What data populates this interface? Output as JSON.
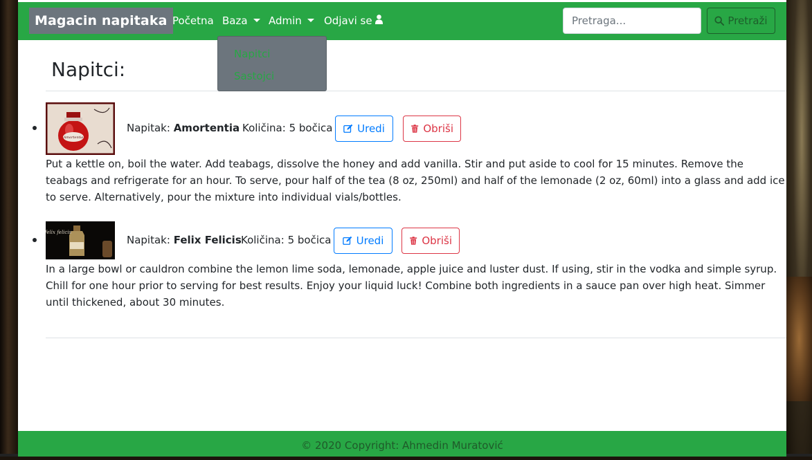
{
  "navbar": {
    "brand": "Magacin napitaka",
    "home_label": "Početna",
    "baza_label": "Baza",
    "admin_label": "Admin",
    "logout_label": "Odjavi se",
    "search_placeholder": "Pretraga...",
    "search_button": "Pretraži"
  },
  "dropdown": {
    "items": [
      "Napitci",
      "Sastojci"
    ]
  },
  "main": {
    "title": "Napitci:",
    "drinks": [
      {
        "drink_label": "Napitak:",
        "name": "Amortentia",
        "quantity_label": "Količina:",
        "quantity": "5 bočica",
        "edit_label": "Uredi",
        "delete_label": "Obriši",
        "description": "Put a kettle on, boil the water. Add teabags, dissolve the honey and add vanilla. Stir and put aside to cool for 15 minutes. Remove the teabags and refrigerate for an hour. To serve, pour half of the tea (8 oz, 250ml) and half of the lemonade (2 oz, 60ml) into a glass and add ice to serve. Alternatively, pour the mixture into individual vials/bottles.",
        "image_label": "Amortentia"
      },
      {
        "drink_label": "Napitak:",
        "name": "Felix Felicis",
        "quantity_label": "Količina:",
        "quantity": "5 bočica",
        "edit_label": "Uredi",
        "delete_label": "Obriši",
        "description": "In a large bowl or cauldron combine the lemon lime soda, lemonade, apple juice and luster dust. If using, stir in the vodka and simple syrup. Chill for one hour prior to serving for best results. Enjoy your liquid luck! Combine both ingredients in a sauce pan over high heat. Simmer until thickened, about 30 minutes.",
        "image_label": "felix felicis"
      }
    ]
  },
  "footer": {
    "copyright": "© 2020 Copyright: Ahmedin Muratović"
  },
  "colors": {
    "navbar": "#28a745",
    "brand_bg": "#6c757d",
    "edit": "#007bff",
    "delete": "#dc3545"
  }
}
